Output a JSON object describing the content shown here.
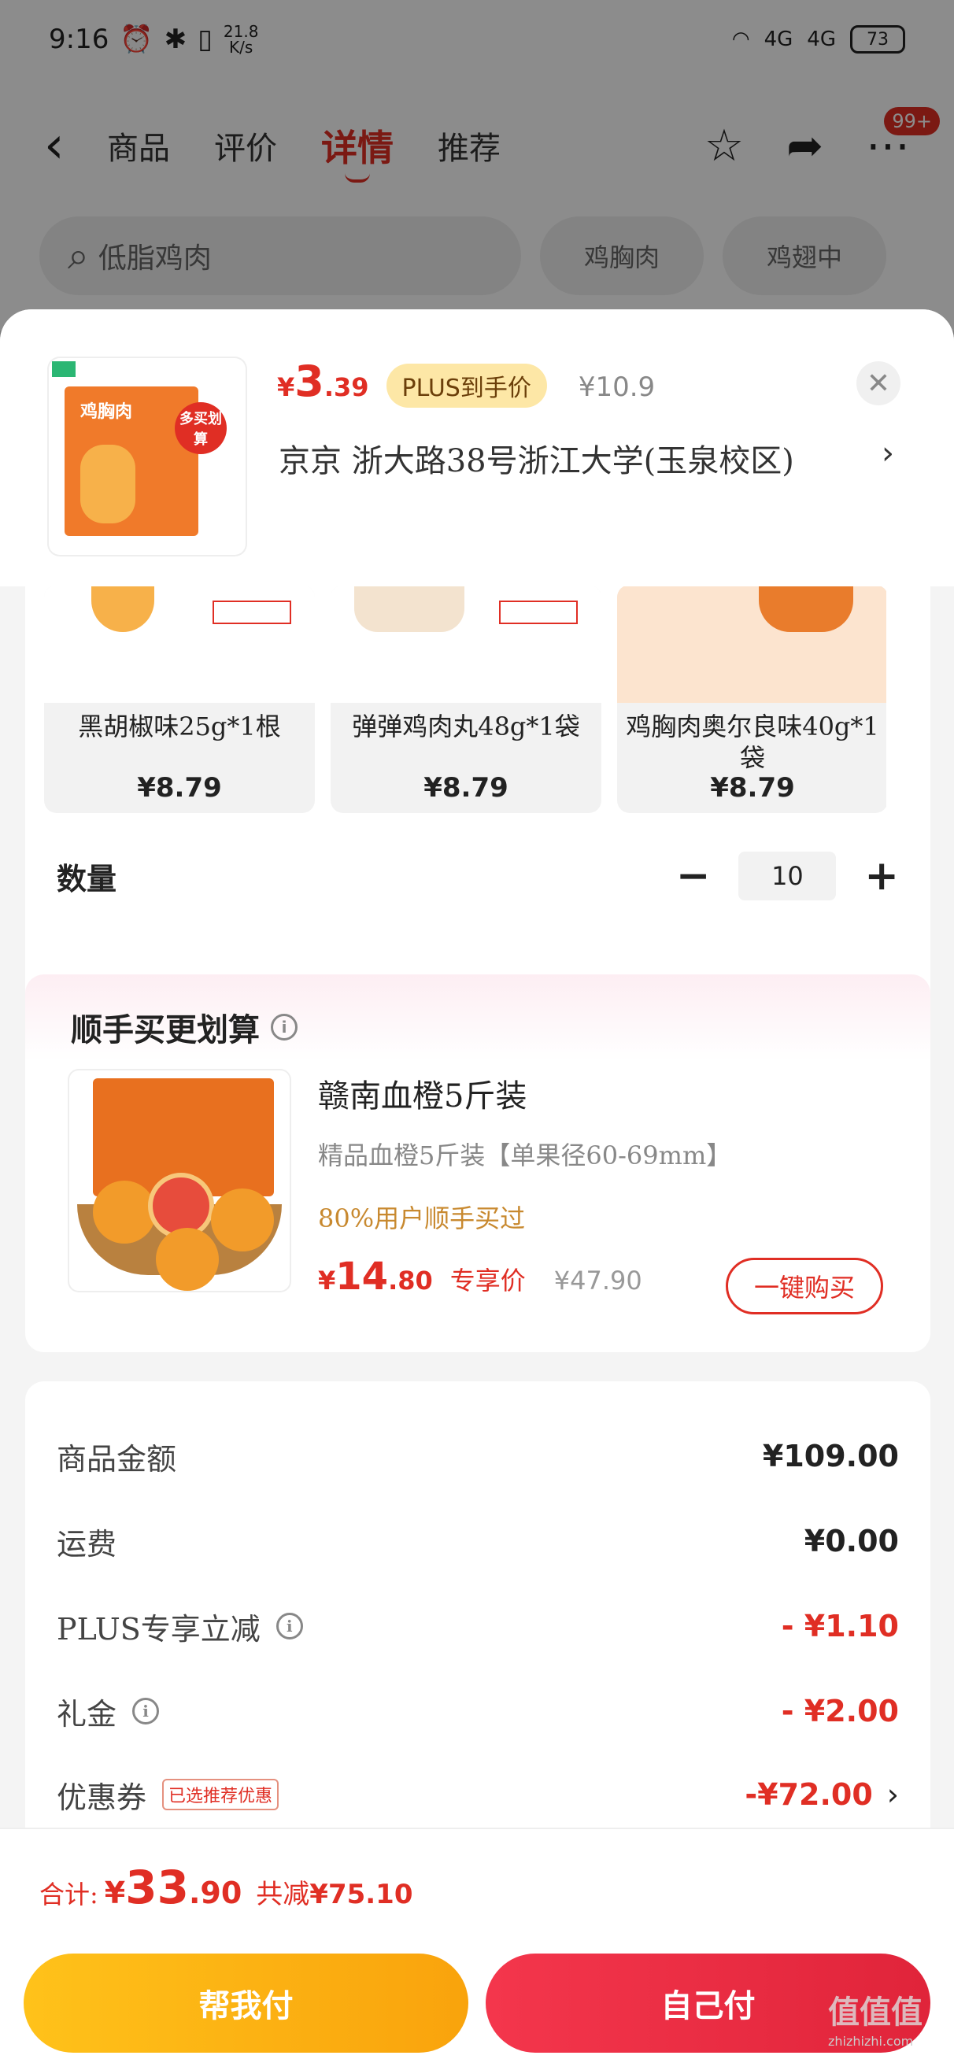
{
  "status_bar": {
    "time": "9:16",
    "speed": "21.8",
    "speed_unit": "K/s",
    "net1": "4G",
    "net2": "4G",
    "battery": "73"
  },
  "nav": {
    "tabs": [
      "商品",
      "评价",
      "详情",
      "推荐"
    ],
    "active_tab": "详情",
    "badge": "99+"
  },
  "search": {
    "placeholder": "低脂鸡肉",
    "chips": [
      "鸡胸肉",
      "鸡翅中"
    ]
  },
  "product": {
    "price_currency": "¥",
    "price_int": "3",
    "price_dec": ".39",
    "plus_tag": "PLUS到手价",
    "original_price": "¥10.9",
    "address": "京京   浙大路38号浙江大学(玉泉校区)",
    "address_arrow": "›",
    "thumb_label": "鸡胸肉",
    "thumb_stamp": "多买划算"
  },
  "variants": [
    {
      "name": "黑胡椒味25g*1根",
      "price": "¥8.79"
    },
    {
      "name": "弹弹鸡肉丸48g*1袋",
      "price": "¥8.79"
    },
    {
      "name": "鸡胸肉奥尔良味40g*1袋",
      "price": "¥8.79"
    }
  ],
  "quantity": {
    "label": "数量",
    "value": "10",
    "minus": "−",
    "plus": "+"
  },
  "upsell": {
    "title": "顺手买更划算",
    "name": "赣南血橙5斤装",
    "desc": "精品血橙5斤装【单果径60-69mm】",
    "pct": "80%用户顺手买过",
    "price_currency": "¥",
    "price_int": "14",
    "price_dec": ".80",
    "price_label": "专享价",
    "old_price": "¥47.90",
    "buy_label": "一键购买"
  },
  "summary": {
    "goods_label": "商品金额",
    "goods_value": "¥109.00",
    "shipping_label": "运费",
    "shipping_value": "¥0.00",
    "plus_label": "PLUS专享立减",
    "plus_value": "- ¥1.10",
    "gift_label": "礼金",
    "gift_value": "- ¥2.00",
    "coupon_label": "优惠券",
    "coupon_tag": "已选推荐优惠",
    "coupon_value": "-¥72.00"
  },
  "footer": {
    "total_label": "合计:",
    "total_currency": "¥",
    "total_int": "33",
    "total_dec": ".90",
    "saved_label": "共减",
    "saved_amount": "¥75.10",
    "help_pay": "帮我付",
    "self_pay": "自己付"
  },
  "watermark": {
    "text": "值值值",
    "sub": "zhizhizhi.com"
  },
  "colors": {
    "accent": "#e02e24",
    "plus_bg": "#fde7a6",
    "yellow_btn": "#ffc21a",
    "red_btn": "#f4364c"
  }
}
